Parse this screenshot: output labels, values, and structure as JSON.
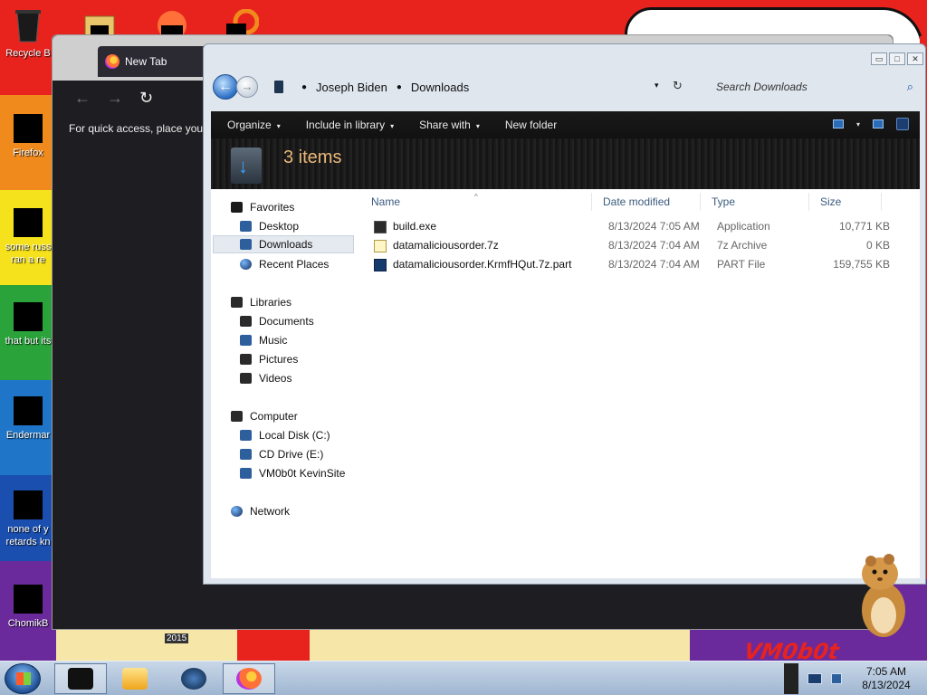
{
  "desktop": {
    "icons": [
      {
        "label": "Recycle B",
        "label2": ""
      },
      {
        "label": "Firefox",
        "label2": ""
      },
      {
        "label": "some russ",
        "label2": "ran a re"
      },
      {
        "label": "that but its",
        "label2": ""
      },
      {
        "label": "Endermar",
        "label2": ""
      },
      {
        "label": "none of y",
        "label2": "retards kn"
      },
      {
        "label": "ChomikB",
        "label2": ""
      }
    ],
    "bottom_year": "2015",
    "corner_text": "VM0b0t"
  },
  "browser": {
    "tab_title": "New Tab",
    "nav": {
      "back": "←",
      "forward": "→",
      "reload": "↻"
    },
    "hint": "For quick access, place your"
  },
  "explorer": {
    "window_controls": {
      "minimize": "▭",
      "maximize": "□",
      "close": "✕"
    },
    "nav": {
      "back": "←",
      "forward": "→"
    },
    "breadcrumb": [
      "Joseph Biden",
      "Downloads"
    ],
    "address_dropdown": "▾",
    "refresh": "↻",
    "search_placeholder": "Search Downloads",
    "commands": [
      {
        "label": "Organize",
        "chevron": "▾"
      },
      {
        "label": "Include in library",
        "chevron": "▾"
      },
      {
        "label": "Share with",
        "chevron": "▾"
      },
      {
        "label": "New folder",
        "chevron": ""
      }
    ],
    "view_chevron": "▾",
    "item_count": "3 items",
    "nav_pane": {
      "favorites": "Favorites",
      "desktop": "Desktop",
      "downloads": "Downloads",
      "recent_places": "Recent Places",
      "libraries": "Libraries",
      "documents": "Documents",
      "music": "Music",
      "pictures": "Pictures",
      "videos": "Videos",
      "computer": "Computer",
      "local_disk": "Local Disk (C:)",
      "cd_drive": "CD Drive (E:)",
      "vm_share": "VM0b0t KevinSite",
      "network": "Network"
    },
    "columns": {
      "name": "Name",
      "date": "Date modified",
      "type": "Type",
      "size": "Size"
    },
    "sort_indicator": "^",
    "files": [
      {
        "name": "build.exe",
        "date": "8/13/2024 7:05 AM",
        "type": "Application",
        "size": "10,771 KB"
      },
      {
        "name": "datamaliciousorder.7z",
        "date": "8/13/2024 7:04 AM",
        "type": "7z Archive",
        "size": "0 KB"
      },
      {
        "name": "datamaliciousorder.KrmfHQut.7z.part",
        "date": "8/13/2024 7:04 AM",
        "type": "PART File",
        "size": "159,755 KB"
      }
    ]
  },
  "taskbar": {
    "clock_time": "7:05 AM",
    "clock_date": "8/13/2024"
  }
}
